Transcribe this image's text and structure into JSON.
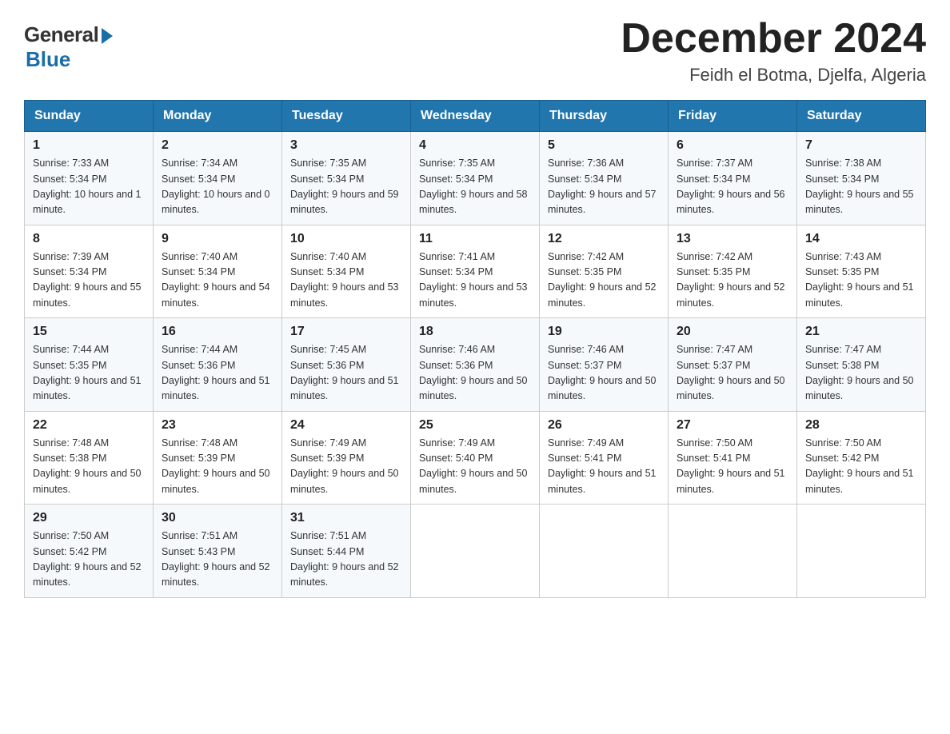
{
  "logo": {
    "general": "General",
    "blue": "Blue"
  },
  "title": {
    "month_year": "December 2024",
    "location": "Feidh el Botma, Djelfa, Algeria"
  },
  "weekdays": [
    "Sunday",
    "Monday",
    "Tuesday",
    "Wednesday",
    "Thursday",
    "Friday",
    "Saturday"
  ],
  "weeks": [
    [
      {
        "day": "1",
        "sunrise": "7:33 AM",
        "sunset": "5:34 PM",
        "daylight": "10 hours and 1 minute."
      },
      {
        "day": "2",
        "sunrise": "7:34 AM",
        "sunset": "5:34 PM",
        "daylight": "10 hours and 0 minutes."
      },
      {
        "day": "3",
        "sunrise": "7:35 AM",
        "sunset": "5:34 PM",
        "daylight": "9 hours and 59 minutes."
      },
      {
        "day": "4",
        "sunrise": "7:35 AM",
        "sunset": "5:34 PM",
        "daylight": "9 hours and 58 minutes."
      },
      {
        "day": "5",
        "sunrise": "7:36 AM",
        "sunset": "5:34 PM",
        "daylight": "9 hours and 57 minutes."
      },
      {
        "day": "6",
        "sunrise": "7:37 AM",
        "sunset": "5:34 PM",
        "daylight": "9 hours and 56 minutes."
      },
      {
        "day": "7",
        "sunrise": "7:38 AM",
        "sunset": "5:34 PM",
        "daylight": "9 hours and 55 minutes."
      }
    ],
    [
      {
        "day": "8",
        "sunrise": "7:39 AM",
        "sunset": "5:34 PM",
        "daylight": "9 hours and 55 minutes."
      },
      {
        "day": "9",
        "sunrise": "7:40 AM",
        "sunset": "5:34 PM",
        "daylight": "9 hours and 54 minutes."
      },
      {
        "day": "10",
        "sunrise": "7:40 AM",
        "sunset": "5:34 PM",
        "daylight": "9 hours and 53 minutes."
      },
      {
        "day": "11",
        "sunrise": "7:41 AM",
        "sunset": "5:34 PM",
        "daylight": "9 hours and 53 minutes."
      },
      {
        "day": "12",
        "sunrise": "7:42 AM",
        "sunset": "5:35 PM",
        "daylight": "9 hours and 52 minutes."
      },
      {
        "day": "13",
        "sunrise": "7:42 AM",
        "sunset": "5:35 PM",
        "daylight": "9 hours and 52 minutes."
      },
      {
        "day": "14",
        "sunrise": "7:43 AM",
        "sunset": "5:35 PM",
        "daylight": "9 hours and 51 minutes."
      }
    ],
    [
      {
        "day": "15",
        "sunrise": "7:44 AM",
        "sunset": "5:35 PM",
        "daylight": "9 hours and 51 minutes."
      },
      {
        "day": "16",
        "sunrise": "7:44 AM",
        "sunset": "5:36 PM",
        "daylight": "9 hours and 51 minutes."
      },
      {
        "day": "17",
        "sunrise": "7:45 AM",
        "sunset": "5:36 PM",
        "daylight": "9 hours and 51 minutes."
      },
      {
        "day": "18",
        "sunrise": "7:46 AM",
        "sunset": "5:36 PM",
        "daylight": "9 hours and 50 minutes."
      },
      {
        "day": "19",
        "sunrise": "7:46 AM",
        "sunset": "5:37 PM",
        "daylight": "9 hours and 50 minutes."
      },
      {
        "day": "20",
        "sunrise": "7:47 AM",
        "sunset": "5:37 PM",
        "daylight": "9 hours and 50 minutes."
      },
      {
        "day": "21",
        "sunrise": "7:47 AM",
        "sunset": "5:38 PM",
        "daylight": "9 hours and 50 minutes."
      }
    ],
    [
      {
        "day": "22",
        "sunrise": "7:48 AM",
        "sunset": "5:38 PM",
        "daylight": "9 hours and 50 minutes."
      },
      {
        "day": "23",
        "sunrise": "7:48 AM",
        "sunset": "5:39 PM",
        "daylight": "9 hours and 50 minutes."
      },
      {
        "day": "24",
        "sunrise": "7:49 AM",
        "sunset": "5:39 PM",
        "daylight": "9 hours and 50 minutes."
      },
      {
        "day": "25",
        "sunrise": "7:49 AM",
        "sunset": "5:40 PM",
        "daylight": "9 hours and 50 minutes."
      },
      {
        "day": "26",
        "sunrise": "7:49 AM",
        "sunset": "5:41 PM",
        "daylight": "9 hours and 51 minutes."
      },
      {
        "day": "27",
        "sunrise": "7:50 AM",
        "sunset": "5:41 PM",
        "daylight": "9 hours and 51 minutes."
      },
      {
        "day": "28",
        "sunrise": "7:50 AM",
        "sunset": "5:42 PM",
        "daylight": "9 hours and 51 minutes."
      }
    ],
    [
      {
        "day": "29",
        "sunrise": "7:50 AM",
        "sunset": "5:42 PM",
        "daylight": "9 hours and 52 minutes."
      },
      {
        "day": "30",
        "sunrise": "7:51 AM",
        "sunset": "5:43 PM",
        "daylight": "9 hours and 52 minutes."
      },
      {
        "day": "31",
        "sunrise": "7:51 AM",
        "sunset": "5:44 PM",
        "daylight": "9 hours and 52 minutes."
      },
      null,
      null,
      null,
      null
    ]
  ],
  "labels": {
    "sunrise": "Sunrise:",
    "sunset": "Sunset:",
    "daylight": "Daylight:"
  }
}
